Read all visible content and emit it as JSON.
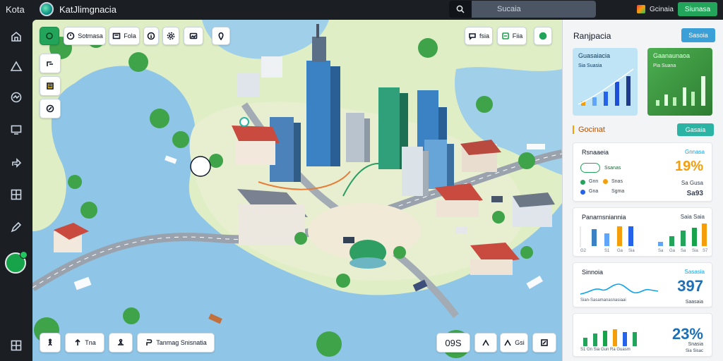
{
  "topbar": {
    "brand": "Kota",
    "app_title": "KatJlimgnacia",
    "search_placeholder": "Sucaia",
    "user_label": "Gcinaia",
    "cta_label": "Siunasa"
  },
  "map_toolbar": {
    "layers_label": "Sotmasa",
    "view_label": "Fola",
    "right_tool_1_label": "fsia",
    "right_tool_2_label": "Fiia"
  },
  "map_bottom": {
    "tool_2_label": "Tna",
    "tool_4_label": "Tanmag Snisnatia",
    "zoom_label": "09S",
    "tool_7_label": "Gsi"
  },
  "panel": {
    "title": "Ranjpacia",
    "button": "Sasoia",
    "tiles": [
      {
        "label": "Guasaiacia",
        "sub": "Sia Suasia"
      },
      {
        "label": "Gaanaunaoa",
        "sub": "Pia Suana"
      }
    ],
    "section_title": "Gocinat",
    "section_button": "Gasaia",
    "cards": [
      {
        "title": "Rsnaaeia",
        "sub": "Gnnasa",
        "big": "19%",
        "row1": "Ssanas",
        "row2": "Gnn",
        "row2b": "Snas",
        "row3": "Gna",
        "row3b": "Sgma",
        "small1": "Sa Gusa",
        "small2": "Sa93"
      },
      {
        "title": "Panarnsniannia",
        "sub": "Saia Saia",
        "big": "",
        "ticks": [
          "G2",
          "S1",
          "Ga",
          "Sia",
          "Sa",
          "Ga",
          "Sa",
          "Sia",
          "S7"
        ]
      },
      {
        "title": "Sinnoia",
        "sub": "Sasasia",
        "big": "397",
        "foot": "Sian-Sasamanasnasiaai",
        "small": "Saasaia"
      },
      {
        "title": "",
        "sub": "",
        "big": "23%",
        "small": "Snasia",
        "foot": "S1 Gn Sia Gun Ra Guasm",
        "foot_r": "Sia Sisac"
      }
    ]
  },
  "colors": {
    "accent_green": "#22a55a",
    "accent_blue": "#3b9fd8",
    "accent_teal": "#2bb3a3",
    "water": "#8fc6e8",
    "grass": "#dfeec5"
  }
}
